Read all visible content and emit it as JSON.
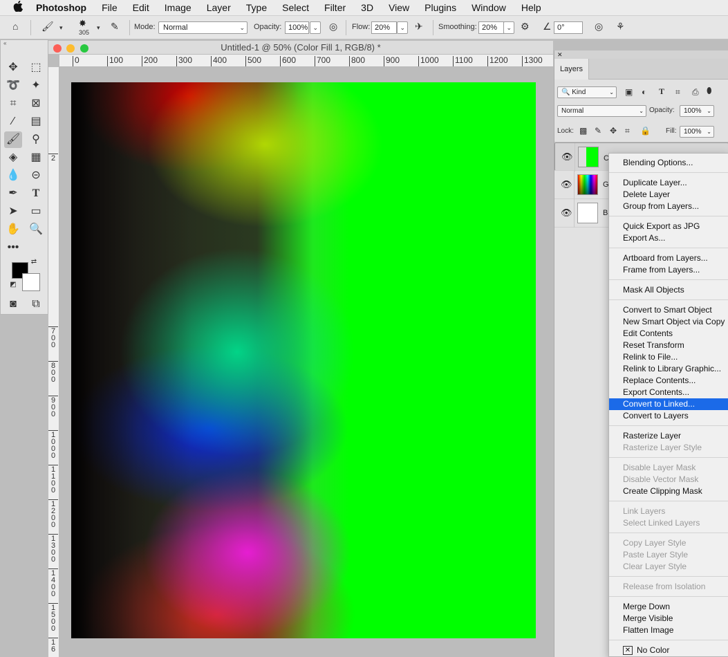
{
  "menubar": {
    "apple": "",
    "items": [
      "Photoshop",
      "File",
      "Edit",
      "Image",
      "Layer",
      "Type",
      "Select",
      "Filter",
      "3D",
      "View",
      "Plugins",
      "Window",
      "Help"
    ]
  },
  "options": {
    "brush_size": "305",
    "mode_label": "Mode:",
    "mode_value": "Normal",
    "opacity_label": "Opacity:",
    "opacity_value": "100%",
    "flow_label": "Flow:",
    "flow_value": "20%",
    "smoothing_label": "Smoothing:",
    "smoothing_value": "20%",
    "angle_value": "0°"
  },
  "document": {
    "title": "Untitled-1 @ 50% (Color Fill 1, RGB/8) *",
    "h_ruler": [
      "0",
      "100",
      "200",
      "300",
      "400",
      "500",
      "600",
      "700",
      "800",
      "900",
      "1000",
      "1100",
      "1200",
      "1300"
    ],
    "v_ruler": [
      "2",
      "7\n0\n0",
      "8\n0\n0",
      "9\n0\n0",
      "1\n0\n0\n0",
      "1\n1\n0\n0",
      "1\n2\n0\n0",
      "1\n3\n0\n0",
      "1\n4\n0\n0",
      "1\n5\n0\n0",
      "1\n6"
    ]
  },
  "layers_panel": {
    "tab": "Layers",
    "kind_label": "Kind",
    "blend_mode": "Normal",
    "opacity_label": "Opacity:",
    "opacity_value": "100%",
    "lock_label": "Lock:",
    "fill_label": "Fill:",
    "fill_value": "100%",
    "layers": [
      {
        "name": "Co",
        "selected": true
      },
      {
        "name": "Gr",
        "selected": false
      },
      {
        "name": "Ba",
        "selected": false
      }
    ]
  },
  "context_menu": {
    "items": [
      "Blending Options...",
      "Duplicate Layer...",
      "Delete Layer",
      "Group from Layers...",
      "Quick Export as JPG",
      "Export As...",
      "Artboard from Layers...",
      "Frame from Layers...",
      "Mask All Objects",
      "Convert to Smart Object",
      "New Smart Object via Copy",
      "Edit Contents",
      "Reset Transform",
      "Relink to File...",
      "Relink to Library Graphic...",
      "Replace Contents...",
      "Export Contents...",
      "Convert to Linked...",
      "Convert to Layers",
      "Rasterize Layer",
      "Rasterize Layer Style",
      "Disable Layer Mask",
      "Disable Vector Mask",
      "Create Clipping Mask",
      "Link Layers",
      "Select Linked Layers",
      "Copy Layer Style",
      "Paste Layer Style",
      "Clear Layer Style",
      "Release from Isolation",
      "Merge Down",
      "Merge Visible",
      "Flatten Image",
      "No Color"
    ],
    "highlighted": "Convert to Linked..."
  },
  "colors": {
    "menu_highlight": "#1b6ae8",
    "foreground": "#000000",
    "background": "#ffffff"
  }
}
